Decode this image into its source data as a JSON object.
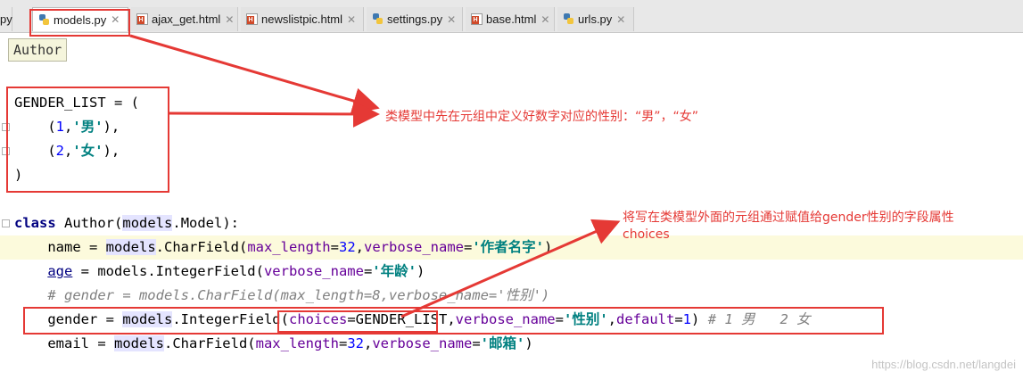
{
  "tabs": [
    {
      "label": "models.py",
      "type": "py",
      "active": true
    },
    {
      "label": "ajax_get.html",
      "type": "html",
      "active": false
    },
    {
      "label": "newslistpic.html",
      "type": "html",
      "active": false
    },
    {
      "label": "settings.py",
      "type": "py",
      "active": false
    },
    {
      "label": "base.html",
      "type": "html",
      "active": false
    },
    {
      "label": "urls.py",
      "type": "py",
      "active": false
    }
  ],
  "partial_tab": "py",
  "breadcrumb": "Author",
  "code": {
    "gender_list_open": "GENDER_LIST = (",
    "tuple1": {
      "num": "1",
      "str": "'男'"
    },
    "tuple2": {
      "num": "2",
      "str": "'女'"
    },
    "close_paren": ")",
    "class_kw": "class",
    "class_name": "Author",
    "class_base_pre": "(",
    "class_base_models": "models",
    "class_base_post": ".Model):",
    "name_line": {
      "lhs": "name = ",
      "models": "models",
      "call": ".CharField(",
      "p1": "max_length",
      "v1": "32",
      "p2": "verbose_name",
      "s": "'作者名字'",
      "end": ")"
    },
    "age_line": {
      "lhs": "age",
      "eq": " = models.IntegerField(",
      "p1": "verbose_name",
      "s": "'年龄'",
      "end": ")"
    },
    "comment_line": "# gender = models.CharField(max_length=8,verbose_name='性别')",
    "gender_line": {
      "lhs": "gender = ",
      "models": "models",
      "call": ".IntegerField(",
      "p1": "choices",
      "v1": "GENDER_LIST",
      "p2": "verbose_name",
      "s": "'性别'",
      "p3": "default",
      "v3": "1",
      "end": ")",
      "cmt": " # 1 男   2 女"
    },
    "email_line": {
      "lhs": "email = ",
      "models": "models",
      "call": ".CharField(",
      "p1": "max_length",
      "v1": "32",
      "p2": "verbose_name",
      "s": "'邮箱'",
      "end": ")"
    }
  },
  "annotations": {
    "note1": "类模型中先在元组中定义好数字对应的性别：“男”，“女”",
    "note2_line1": "将写在类模型外面的元组通过赋值给gender性别的字段属性",
    "note2_line2": "choices"
  },
  "colors": {
    "annotation": "#e53935",
    "highlight_line": "#fcfadc"
  },
  "watermark": "https://blog.csdn.net/langdei"
}
